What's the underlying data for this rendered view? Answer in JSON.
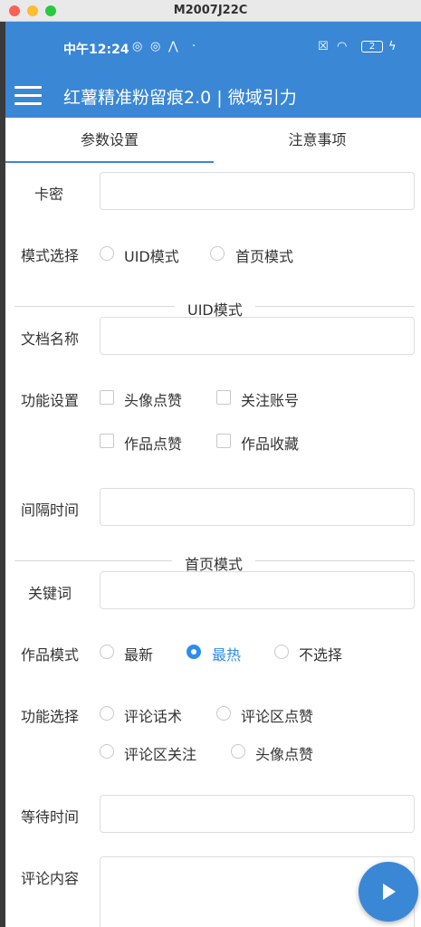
{
  "window": {
    "title": "M2007J22C"
  },
  "status_bar": {
    "time": "中午12:24",
    "battery": "2"
  },
  "app_bar": {
    "title": "红薯精准粉留痕2.0 | 微域引力"
  },
  "tabs": [
    "参数设置",
    "注意事项"
  ],
  "form": {
    "card_key_label": "卡密",
    "mode_label": "模式选择",
    "mode_options": [
      "UID模式",
      "首页模式"
    ],
    "uid_section": "UID模式",
    "doc_name_label": "文档名称",
    "func_settings_label": "功能设置",
    "func_settings_options": [
      "头像点赞",
      "关注账号",
      "作品点赞",
      "作品收藏"
    ],
    "interval_label": "间隔时间",
    "home_section": "首页模式",
    "keyword_label": "关键词",
    "work_mode_label": "作品模式",
    "work_mode_options": [
      "最新",
      "最热",
      "不选择"
    ],
    "work_mode_selected": "最热",
    "func_select_label": "功能选择",
    "func_select_options": [
      "评论话术",
      "评论区点赞",
      "评论区关注",
      "头像点赞"
    ],
    "wait_time_label": "等待时间",
    "comment_label": "评论内容"
  },
  "colors": {
    "primary": "#3a87d6",
    "selected": "#2d8cf0"
  }
}
